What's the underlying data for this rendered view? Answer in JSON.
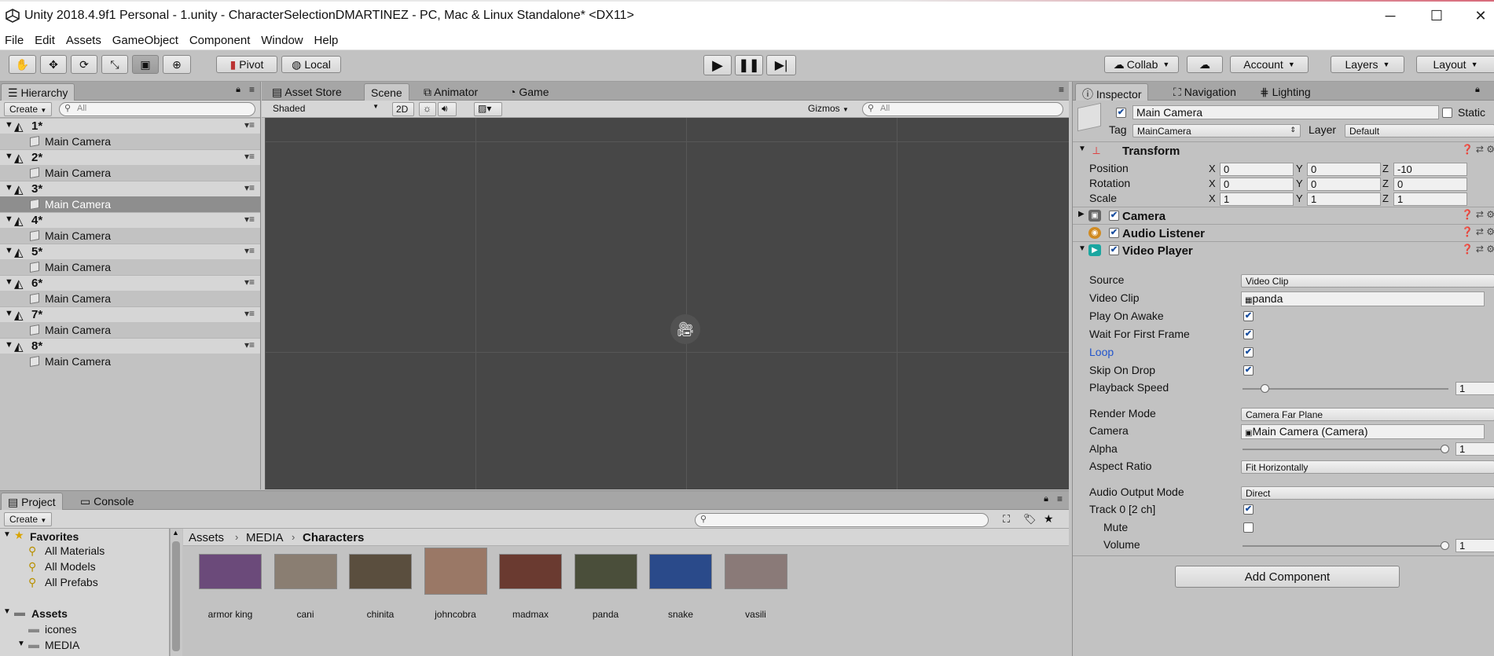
{
  "window": {
    "title": "Unity 2018.4.9f1 Personal - 1.unity - CharacterSelectionDMARTINEZ - PC, Mac & Linux Standalone* <DX11>",
    "minimize_icon": "─",
    "maximize_icon": "☐",
    "close_icon": "✕"
  },
  "menu": [
    "File",
    "Edit",
    "Assets",
    "GameObject",
    "Component",
    "Window",
    "Help"
  ],
  "toolbar": {
    "pivot": "Pivot",
    "local": "Local",
    "collab": "Collab",
    "account": "Account",
    "layers": "Layers",
    "layout": "Layout"
  },
  "hierarchy": {
    "tab": "Hierarchy",
    "create": "Create",
    "search_placeholder": "All",
    "scenes": [
      {
        "name": "1*",
        "child": "Main Camera"
      },
      {
        "name": "2*",
        "child": "Main Camera"
      },
      {
        "name": "3*",
        "child": "Main Camera",
        "selected": true
      },
      {
        "name": "4*",
        "child": "Main Camera"
      },
      {
        "name": "5*",
        "child": "Main Camera"
      },
      {
        "name": "6*",
        "child": "Main Camera"
      },
      {
        "name": "7*",
        "child": "Main Camera"
      },
      {
        "name": "8*",
        "child": "Main Camera"
      }
    ]
  },
  "scene_view": {
    "tabs": [
      "Asset Store",
      "Scene",
      "Animator",
      "Game"
    ],
    "shading": "Shaded",
    "mode_2d": "2D",
    "gizmos": "Gizmos",
    "search_placeholder": "All"
  },
  "project": {
    "tabs": [
      "Project",
      "Console"
    ],
    "create": "Create",
    "favorites": {
      "label": "Favorites",
      "items": [
        "All Materials",
        "All Models",
        "All Prefabs"
      ]
    },
    "assets": {
      "label": "Assets",
      "items": [
        "icones",
        "MEDIA"
      ]
    },
    "breadcrumb": [
      "Assets",
      "MEDIA",
      "Characters"
    ],
    "items": [
      {
        "name": "armor king",
        "color": "#6b4a7a"
      },
      {
        "name": "cani",
        "color": "#8a7e72"
      },
      {
        "name": "chinita",
        "color": "#5a4e3e"
      },
      {
        "name": "johncobra",
        "color": "#9a7866"
      },
      {
        "name": "madmax",
        "color": "#6a3a30"
      },
      {
        "name": "panda",
        "color": "#4a4e3a"
      },
      {
        "name": "snake",
        "color": "#2a4a8a"
      },
      {
        "name": "vasili",
        "color": "#8a7a78"
      }
    ]
  },
  "inspector": {
    "tabs": [
      "Inspector",
      "Navigation",
      "Lighting"
    ],
    "object_name": "Main Camera",
    "static": "Static",
    "tag_label": "Tag",
    "tag": "MainCamera",
    "layer_label": "Layer",
    "layer": "Default",
    "transform": {
      "title": "Transform",
      "position": {
        "label": "Position",
        "x": "0",
        "y": "0",
        "z": "-10"
      },
      "rotation": {
        "label": "Rotation",
        "x": "0",
        "y": "0",
        "z": "0"
      },
      "scale": {
        "label": "Scale",
        "x": "1",
        "y": "1",
        "z": "1"
      }
    },
    "components": [
      "Camera",
      "Audio Listener",
      "Video Player"
    ],
    "video": {
      "source": {
        "label": "Source",
        "value": "Video Clip"
      },
      "video_clip": {
        "label": "Video Clip",
        "value": "panda"
      },
      "play_on_awake": {
        "label": "Play On Awake",
        "checked": true
      },
      "wait_first_frame": {
        "label": "Wait For First Frame",
        "checked": true
      },
      "loop": {
        "label": "Loop",
        "checked": true
      },
      "skip_on_drop": {
        "label": "Skip On Drop",
        "checked": true
      },
      "playback_speed": {
        "label": "Playback Speed",
        "value": "1"
      },
      "render_mode": {
        "label": "Render Mode",
        "value": "Camera Far Plane"
      },
      "camera": {
        "label": "Camera",
        "value": "Main Camera (Camera)"
      },
      "alpha": {
        "label": "Alpha",
        "value": "1"
      },
      "aspect_ratio": {
        "label": "Aspect Ratio",
        "value": "Fit Horizontally"
      },
      "audio_output_mode": {
        "label": "Audio Output Mode",
        "value": "Direct"
      },
      "track0": {
        "label": "Track 0 [2 ch]",
        "checked": true
      },
      "mute": {
        "label": "Mute",
        "checked": false
      },
      "volume": {
        "label": "Volume",
        "value": "1"
      }
    },
    "add_component": "Add Component"
  },
  "colors": {
    "selected_row": "#8e8e8e",
    "scene_bg": "#474747",
    "loop_label": "#2255cc"
  }
}
